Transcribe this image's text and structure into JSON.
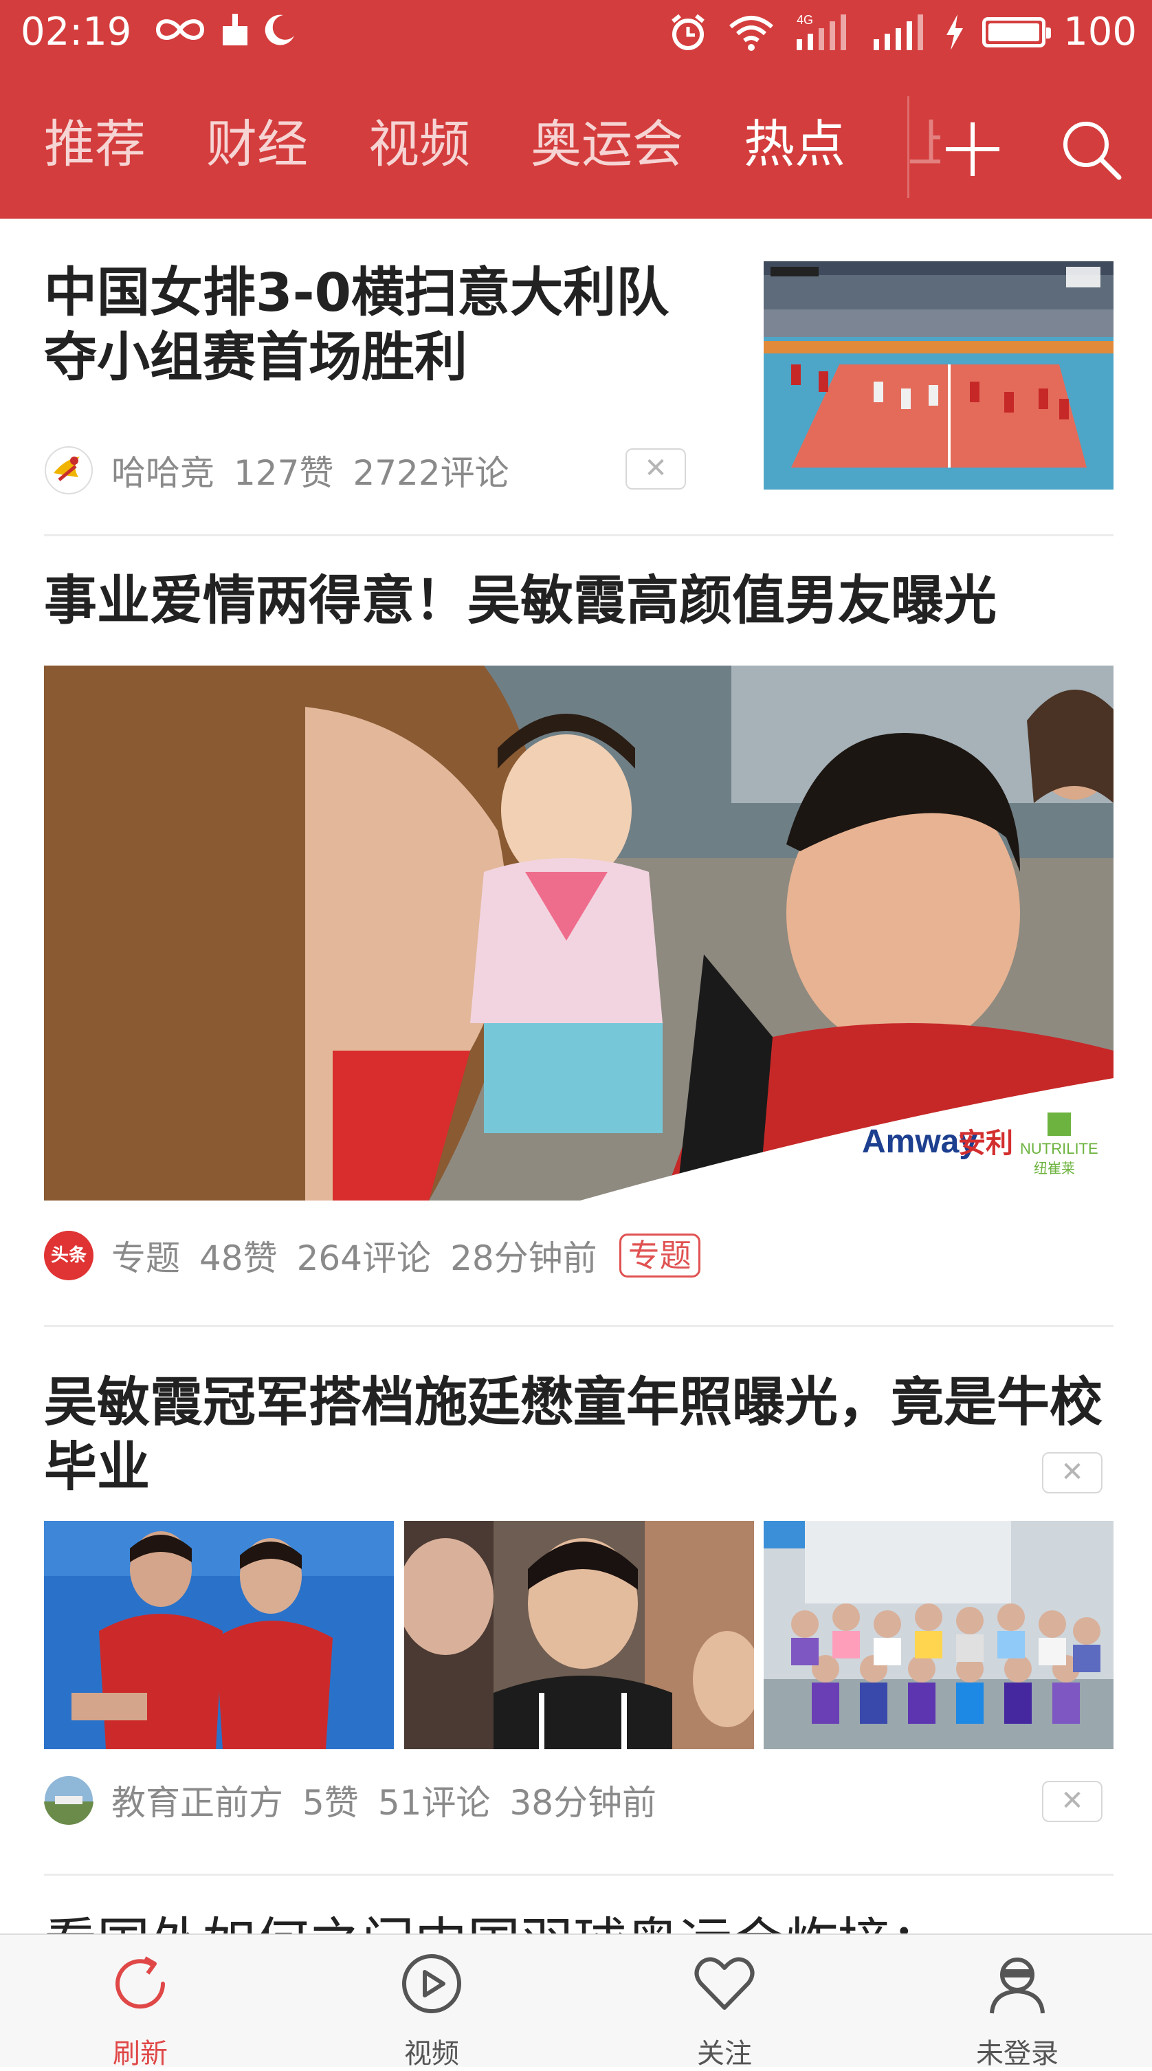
{
  "status_bar": {
    "time": "02:19",
    "network": "4G",
    "battery": "100",
    "icons": [
      "infinity-icon",
      "broom-icon",
      "moon-icon",
      "alarm-icon",
      "wifi-icon",
      "signal-icon",
      "charging-icon",
      "battery-icon"
    ]
  },
  "nav": {
    "tabs": [
      {
        "label": "推荐",
        "active": false
      },
      {
        "label": "财经",
        "active": false
      },
      {
        "label": "视频",
        "active": false
      },
      {
        "label": "奥运会",
        "active": false
      },
      {
        "label": "热点",
        "active": true
      }
    ],
    "peek_label": "上",
    "icons": {
      "add": "plus-icon",
      "search": "search-icon"
    }
  },
  "articles": [
    {
      "title": "中国女排3-0横扫意大利队夺小组赛首场胜利",
      "source": "哈哈竞",
      "likes": "127赞",
      "comments": "2722评论",
      "dismiss": "✕",
      "image": "volleyball-match-thumbnail"
    },
    {
      "title": "事业爱情两得意！吴敏霞高颜值男友曝光",
      "source": "专题",
      "source_badge": "头条",
      "likes": "48赞",
      "comments": "264评论",
      "time": "28分钟前",
      "tag": "专题",
      "dismiss": "✕",
      "image_brand_1": "Amway",
      "image_brand_1_cn": "安利",
      "image_brand_2": "NUTRILITE",
      "image_brand_2_cn": "纽崔莱"
    },
    {
      "title": "吴敏霞冠军搭档施廷懋童年照曝光，竟是牛校毕业",
      "source": "教育正前方",
      "likes": "5赞",
      "comments": "51评论",
      "time": "38分钟前",
      "dismiss": "✕",
      "images": [
        "divers-photo",
        "boy-childhood-photo",
        "group-class-photo"
      ]
    },
    {
      "title": "看国外如何之门中国羽球奥运会炸接："
    }
  ],
  "bottom_nav": [
    {
      "label": "刷新",
      "icon": "refresh-icon",
      "active": true
    },
    {
      "label": "视频",
      "icon": "play-icon",
      "active": false
    },
    {
      "label": "关注",
      "icon": "heart-icon",
      "active": false
    },
    {
      "label": "未登录",
      "icon": "user-icon",
      "active": false
    }
  ],
  "colors": {
    "brand_red": "#d43d3d",
    "active_tab_label": "#e04848",
    "meta_gray": "#8a8a8a"
  }
}
